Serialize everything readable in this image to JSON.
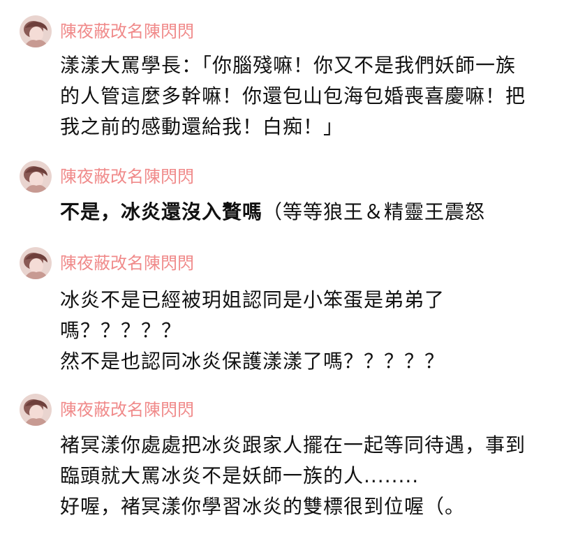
{
  "comments": [
    {
      "username": "陳夜蔽改名陳閃閃",
      "lines": [
        "漾漾大罵學長：「你腦殘嘛！你又不是我們妖師一族",
        "的人管這麼多幹嘛！你還包山包海包婚喪喜慶嘛！把",
        "我之前的感動還給我！白痴！」"
      ]
    },
    {
      "username": "陳夜蔽改名陳閃閃",
      "bold_part": "不是，冰炎還沒入贅嗎",
      "normal_part": "（等等狼王＆精靈王震怒"
    },
    {
      "username": "陳夜蔽改名陳閃閃",
      "lines": [
        "冰炎不是已經被玥姐認同是小笨蛋是弟弟了",
        "嗎？？？？？",
        "然不是也認同冰炎保護漾漾了嗎？？？？？"
      ]
    },
    {
      "username": "陳夜蔽改名陳閃閃",
      "lines": [
        "褚冥漾你處處把冰炎跟家人擺在一起等同待遇，事到",
        "臨頭就大罵冰炎不是妖師一族的人........",
        "好喔，褚冥漾你學習冰炎的雙標很到位喔（。"
      ]
    }
  ],
  "colors": {
    "username": "#f08a8a",
    "text": "#111111",
    "background": "#ffffff"
  },
  "icons": {
    "avatar": "user-avatar-icon"
  }
}
